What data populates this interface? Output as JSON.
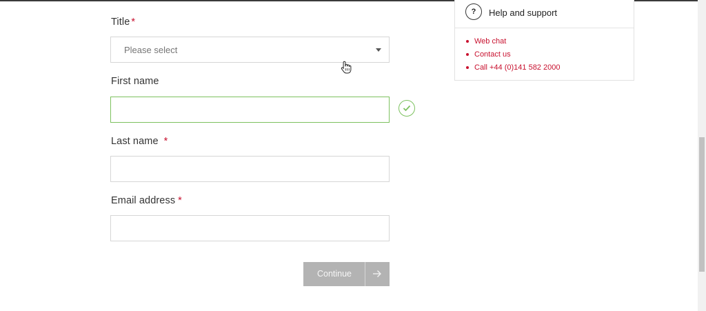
{
  "form": {
    "title_label": "Title",
    "title_select_value": "Please select",
    "first_name_label": "First name",
    "first_name_value": "",
    "last_name_label": "Last name",
    "last_name_value": "",
    "email_label": "Email address",
    "email_value": "",
    "required_marker": "*",
    "continue_label": "Continue"
  },
  "support": {
    "help_glyph": "?",
    "title": "Help and support",
    "links": [
      "Web chat",
      "Contact us",
      "Call +44 (0)141 582 2000"
    ]
  },
  "colors": {
    "accent_red": "#c8102e",
    "valid_green": "#7cc15e",
    "button_disabled": "#b3b3b3"
  },
  "icons": [
    "chevron-down-icon",
    "checkmark-icon",
    "arrow-right-icon",
    "question-icon",
    "hand-cursor-icon"
  ]
}
